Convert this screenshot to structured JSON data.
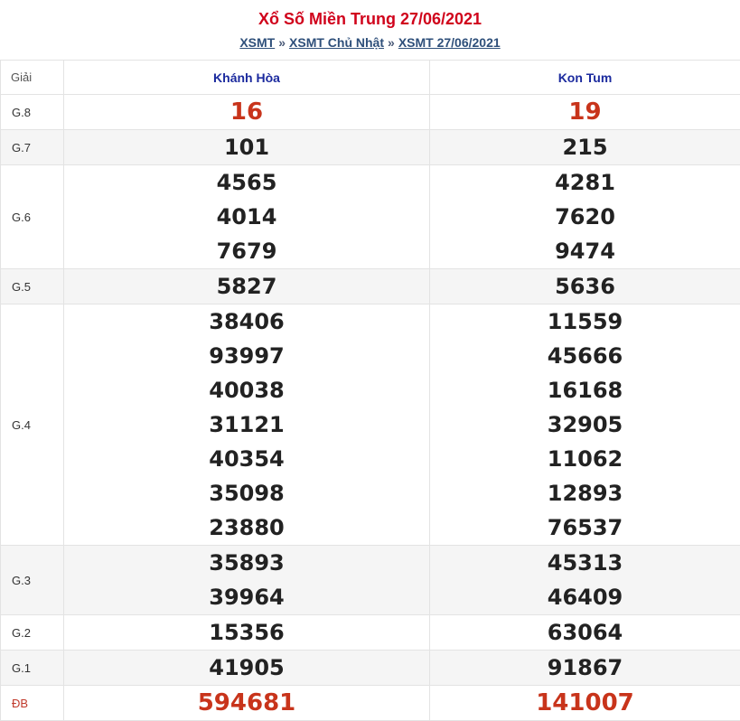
{
  "header": {
    "title": "Xổ Số Miền Trung 27/06/2021",
    "breadcrumb": [
      {
        "label": "XSMT"
      },
      {
        "label": "XSMT Chủ Nhật"
      },
      {
        "label": "XSMT 27/06/2021"
      }
    ],
    "separator": "»"
  },
  "table": {
    "label_header": "Giải",
    "provinces": [
      "Khánh Hòa",
      "Kon Tum"
    ],
    "prizes": [
      {
        "label": "G.8",
        "kh": [
          "16"
        ],
        "kt": [
          "19"
        ]
      },
      {
        "label": "G.7",
        "kh": [
          "101"
        ],
        "kt": [
          "215"
        ]
      },
      {
        "label": "G.6",
        "kh": [
          "4565",
          "4014",
          "7679"
        ],
        "kt": [
          "4281",
          "7620",
          "9474"
        ]
      },
      {
        "label": "G.5",
        "kh": [
          "5827"
        ],
        "kt": [
          "5636"
        ]
      },
      {
        "label": "G.4",
        "kh": [
          "38406",
          "93997",
          "40038",
          "31121",
          "40354",
          "35098",
          "23880"
        ],
        "kt": [
          "11559",
          "45666",
          "16168",
          "32905",
          "11062",
          "12893",
          "76537"
        ]
      },
      {
        "label": "G.3",
        "kh": [
          "35893",
          "39964"
        ],
        "kt": [
          "45313",
          "46409"
        ]
      },
      {
        "label": "G.2",
        "kh": [
          "15356"
        ],
        "kt": [
          "63064"
        ]
      },
      {
        "label": "G.1",
        "kh": [
          "41905"
        ],
        "kt": [
          "91867"
        ]
      },
      {
        "label": "ĐB",
        "kh": [
          "594681"
        ],
        "kt": [
          "141007"
        ]
      }
    ]
  },
  "colors": {
    "title": "#d0021b",
    "province_header": "#1b2a9e",
    "highlight_number": "#c8341b",
    "row_alt_bg": "#f5f5f5"
  }
}
